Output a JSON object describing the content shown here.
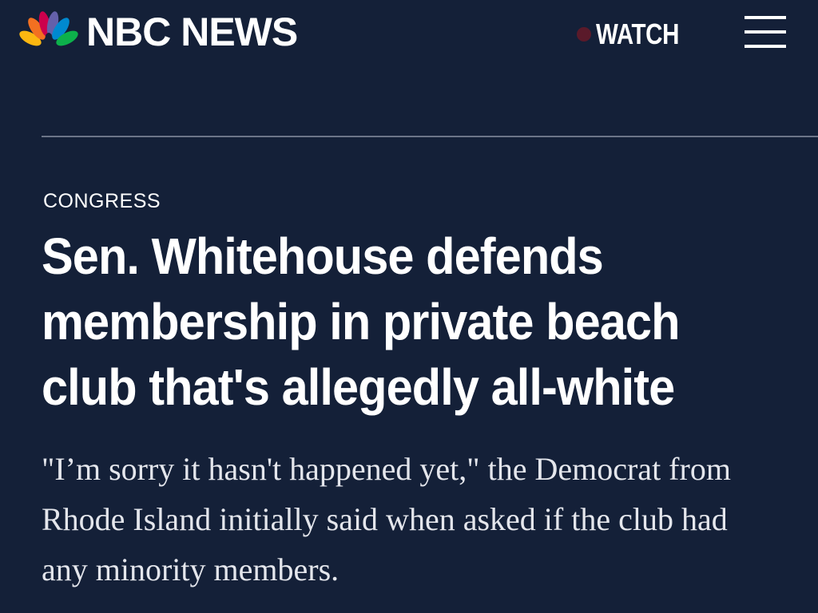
{
  "header": {
    "brand": "NBC NEWS",
    "logo_icon": "peacock-icon",
    "watch_label": "WATCH",
    "live_indicator_color": "#5a1a2a",
    "menu_icon": "hamburger-menu-icon"
  },
  "article": {
    "category": "CONGRESS",
    "headline_lines": [
      "Sen. Whitehouse defends",
      "membership in private beach",
      "club that's allegedly all-white"
    ],
    "dek_lines": [
      "\"I’m sorry it hasn't happened yet,\" the Democrat from",
      "Rhode Island initially said when asked if the club had",
      "any minority members."
    ]
  },
  "colors": {
    "background": "#142038",
    "text": "#ffffff",
    "divider": "#6c7588",
    "peacock": [
      "#fcb711",
      "#f37021",
      "#cc004c",
      "#6460aa",
      "#0089d0",
      "#0db14b"
    ]
  }
}
